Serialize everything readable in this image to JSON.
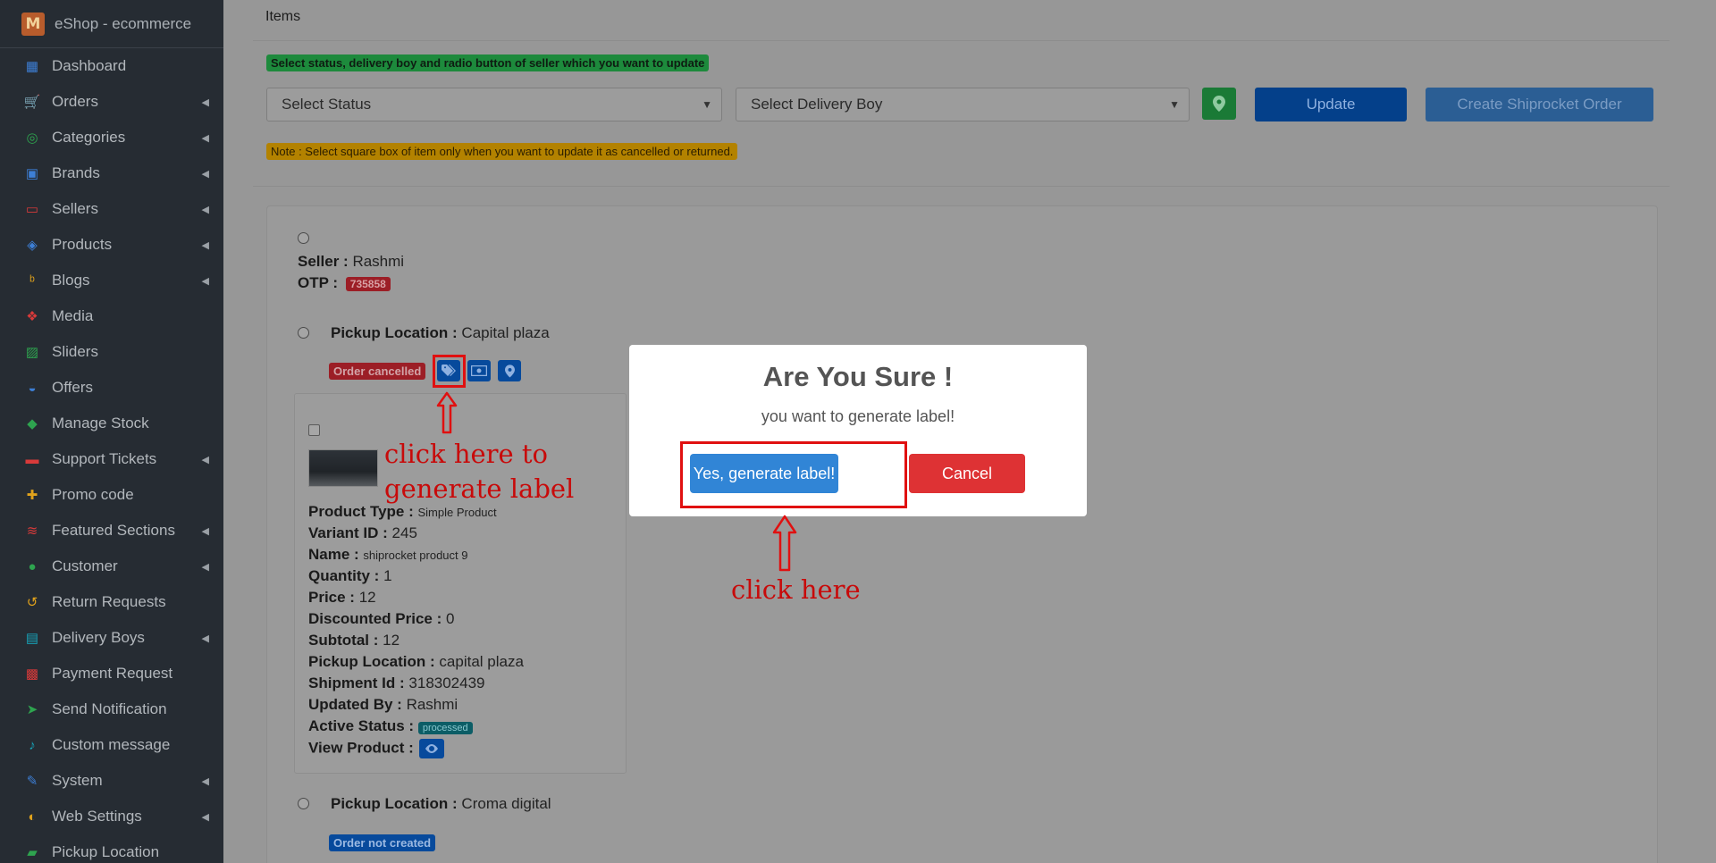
{
  "sidebar": {
    "brand": "eShop - ecommerce",
    "brand_logo_letter": "M",
    "items": [
      {
        "label": "Dashboard",
        "icon": "dashboard-icon",
        "color": "#3d7fd6",
        "chevron": false
      },
      {
        "label": "Orders",
        "icon": "cart-icon",
        "color": "#e0a21c",
        "chevron": true
      },
      {
        "label": "Categories",
        "icon": "target-icon",
        "color": "#2ea44f",
        "chevron": true
      },
      {
        "label": "Brands",
        "icon": "brand-icon",
        "color": "#3d7fd6",
        "chevron": true
      },
      {
        "label": "Sellers",
        "icon": "store-icon",
        "color": "#d83a3a",
        "chevron": true
      },
      {
        "label": "Products",
        "icon": "cubes-icon",
        "color": "#3d7fd6",
        "chevron": true
      },
      {
        "label": "Blogs",
        "icon": "blog-icon",
        "color": "#e0a21c",
        "chevron": true
      },
      {
        "label": "Media",
        "icon": "media-icon",
        "color": "#d83a3a",
        "chevron": false
      },
      {
        "label": "Sliders",
        "icon": "image-icon",
        "color": "#2ea44f",
        "chevron": false
      },
      {
        "label": "Offers",
        "icon": "gift-icon",
        "color": "#3d7fd6",
        "chevron": false
      },
      {
        "label": "Manage Stock",
        "icon": "box-icon",
        "color": "#2ea44f",
        "chevron": false
      },
      {
        "label": "Support Tickets",
        "icon": "ticket-icon",
        "color": "#d83a3a",
        "chevron": true
      },
      {
        "label": "Promo code",
        "icon": "puzzle-icon",
        "color": "#e0a21c",
        "chevron": false
      },
      {
        "label": "Featured Sections",
        "icon": "layers-icon",
        "color": "#d83a3a",
        "chevron": true
      },
      {
        "label": "Customer",
        "icon": "user-icon",
        "color": "#2ea44f",
        "chevron": true
      },
      {
        "label": "Return Requests",
        "icon": "undo-icon",
        "color": "#e0a21c",
        "chevron": false
      },
      {
        "label": "Delivery Boys",
        "icon": "idcard-icon",
        "color": "#17a2b8",
        "chevron": true
      },
      {
        "label": "Payment Request",
        "icon": "money-icon",
        "color": "#d83a3a",
        "chevron": false
      },
      {
        "label": "Send Notification",
        "icon": "paper-plane-icon",
        "color": "#2ea44f",
        "chevron": false
      },
      {
        "label": "Custom message",
        "icon": "bell-icon",
        "color": "#17a2b8",
        "chevron": false
      },
      {
        "label": "System",
        "icon": "wrench-icon",
        "color": "#3d7fd6",
        "chevron": true
      },
      {
        "label": "Web Settings",
        "icon": "palette-icon",
        "color": "#e0a21c",
        "chevron": true
      },
      {
        "label": "Pickup Location",
        "icon": "truck-icon",
        "color": "#2ea44f",
        "chevron": false
      }
    ]
  },
  "items_section": {
    "title": "Items",
    "status_hint": "Select status, delivery boy and radio button of seller which you want to update",
    "status_placeholder": "Select Status",
    "delivery_placeholder": "Select Delivery Boy",
    "update_label": "Update",
    "shiprocket_label": "Create Shiprocket Order",
    "note": "Note : Select square box of item only when you want to update it as cancelled or returned."
  },
  "seller": {
    "label": "Seller :",
    "name": "Rashmi",
    "otp_label": "OTP :",
    "otp": "735858"
  },
  "pickup1": {
    "label": "Pickup Location :",
    "value": "Capital plaza",
    "status": "Order cancelled"
  },
  "item": {
    "product_type_label": "Product Type :",
    "product_type": "Simple Product",
    "variant_label": "Variant ID :",
    "variant": "245",
    "name_label": "Name :",
    "name": "shiprocket product 9",
    "quantity_label": "Quantity :",
    "quantity": "1",
    "price_label": "Price :",
    "price": "12",
    "discounted_label": "Discounted Price :",
    "discounted": "0",
    "subtotal_label": "Subtotal :",
    "subtotal": "12",
    "pickup_label": "Pickup Location :",
    "pickup": "capital plaza",
    "shipment_label": "Shipment Id :",
    "shipment": "318302439",
    "updated_label": "Updated By :",
    "updated": "Rashmi",
    "active_label": "Active Status :",
    "active": "processed",
    "view_label": "View Product :"
  },
  "pickup2": {
    "label": "Pickup Location :",
    "value": "Croma digital",
    "status": "Order not created"
  },
  "annotations": {
    "generate_label_hint_line1": "click here to",
    "generate_label_hint_line2": "generate label",
    "click_here": "click here",
    "color": "#c80a0a"
  },
  "modal": {
    "title": "Are You Sure !",
    "text": "you want to generate label!",
    "confirm_label": "Yes, generate label!",
    "cancel_label": "Cancel"
  }
}
